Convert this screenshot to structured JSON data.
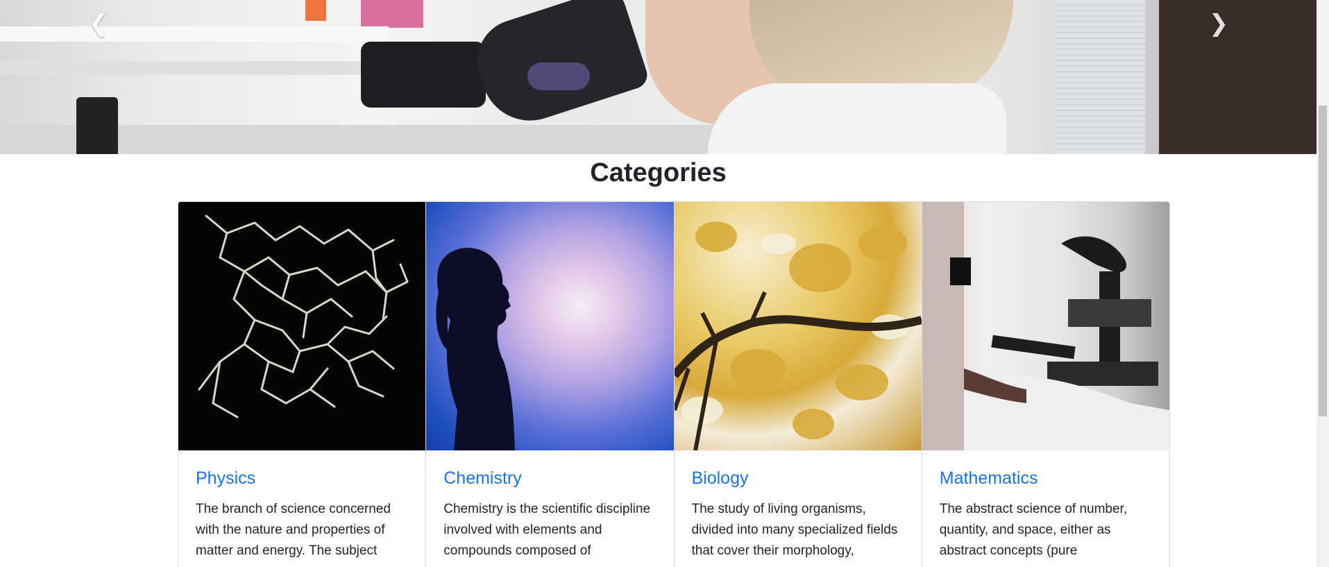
{
  "carousel": {
    "prev_icon": "chevron-left-icon",
    "next_icon": "chevron-right-icon",
    "prev_glyph": "❮",
    "next_glyph": "❯"
  },
  "section": {
    "title": "Categories"
  },
  "cards": [
    {
      "title": "Physics",
      "text": "The branch of science concerned with the nature and properties of matter and energy. The subject"
    },
    {
      "title": "Chemistry",
      "text": "Chemistry is the scientific discipline involved with elements and compounds composed of"
    },
    {
      "title": "Biology",
      "text": "The study of living organisms, divided into many specialized fields that cover their morphology,"
    },
    {
      "title": "Mathematics",
      "text": "The abstract science of number, quantity, and space, either as abstract concepts (pure"
    }
  ],
  "colors": {
    "link": "#1a73e8",
    "text": "#212529",
    "border": "#dcdcdc"
  }
}
